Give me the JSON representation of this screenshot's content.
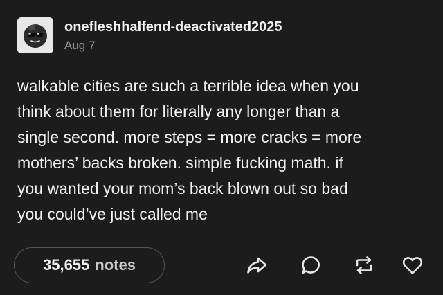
{
  "post": {
    "username": "onefleshhalfend-deactivated2025",
    "date": "Aug 7",
    "body_lines": [
      "walkable cities are such a terrible idea when you",
      "think about them for literally any longer than a",
      "single second. more steps = more cracks = more",
      "mothers’ backs broken. simple fucking math. if",
      "you wanted your mom’s back blown out so bad",
      "you could’ve just called me"
    ],
    "notes": {
      "count": "35,655",
      "label": "notes"
    },
    "avatar_icon": "sunglasses-face-icon",
    "actions": [
      "share-icon",
      "reply-icon",
      "reblog-icon",
      "like-icon"
    ]
  },
  "colors": {
    "background": "#1c1c1c",
    "text": "#f2f2f2",
    "muted": "#9a9a9a",
    "pill_border": "#555555"
  }
}
